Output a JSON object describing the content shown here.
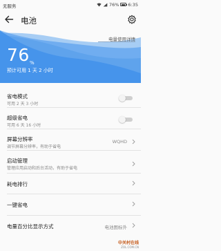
{
  "status_bar": {
    "carrier": "无服务",
    "battery_percent": "76%",
    "time": "6:35"
  },
  "header": {
    "title": "电池"
  },
  "battery": {
    "percent": "76",
    "percent_sign": "%",
    "estimate": "预计可用 1 天 2 小时",
    "detail_link": "电量使用详情"
  },
  "settings": [
    {
      "id": "power-saving",
      "label": "省电模式",
      "sub": "可用 2 天 3 小时",
      "toggle": false
    },
    {
      "id": "ultra-power-saving",
      "label": "超级省电",
      "sub": "可用 6 天 16 小时",
      "toggle": false
    },
    {
      "id": "screen-resolution",
      "label": "屏幕分辨率",
      "sub": "调节屏幕分辨率，有助于省电",
      "value": "WQHD"
    },
    {
      "id": "startup-manager",
      "label": "启动管理",
      "sub": "管理应用启动和后台活动，有助于省电"
    },
    {
      "id": "power-ranking",
      "label": "耗电排行"
    },
    {
      "id": "one-tap-saving",
      "label": "一键省电"
    },
    {
      "id": "percentage-display",
      "label": "电量百分比显示方式",
      "value": "电池图标外"
    }
  ],
  "watermark": {
    "logo": "中关村在线",
    "url": "ZOL.COM.CN"
  },
  "colors": {
    "wave_front": "#3d8ee8",
    "wave_back": "#9fc9f3",
    "accent": "#1a73e8"
  }
}
